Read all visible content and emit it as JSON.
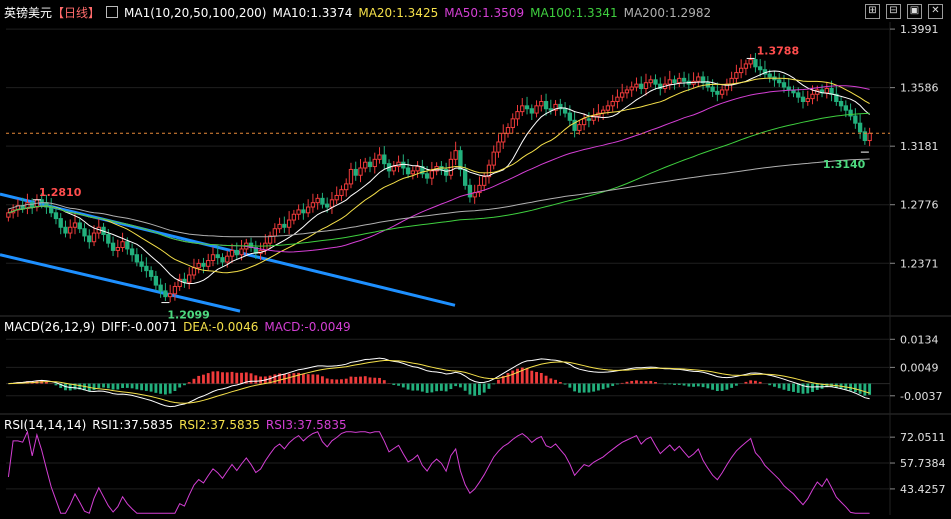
{
  "header": {
    "symbol": "英镑美元",
    "period": "【日线】",
    "settings_glyph": "⊕",
    "ma_title": "MA1(10,20,50,100,200)",
    "ma10": "MA10:1.3374",
    "ma20": "MA20:1.3425",
    "ma50": "MA50:1.3509",
    "ma100": "MA100:1.3341",
    "ma200": "MA200:1.2982"
  },
  "toolbar": {
    "icons": [
      "crosshair-icon",
      "grid-icon",
      "layout-icon",
      "close-icon"
    ],
    "glyphs": [
      "⊞",
      "⊟",
      "▣",
      "✕"
    ]
  },
  "macd_header": {
    "title": "MACD(26,12,9)",
    "diff": "DIFF:-0.0071",
    "dea": "DEA:-0.0046",
    "macd": "MACD:-0.0049"
  },
  "rsi_header": {
    "title": "RSI(14,14,14)",
    "rsi1": "RSI1:37.5835",
    "rsi2": "RSI2:37.5835",
    "rsi3": "RSI3:37.5835"
  },
  "colors": {
    "up": "#ef3b3b",
    "down": "#22b07d",
    "ma10": "#ffffff",
    "ma20": "#f5e04a",
    "ma50": "#d43fd4",
    "ma100": "#3fcf3f",
    "ma200": "#b0b0b0",
    "trend": "#1e90ff",
    "price_line": "#e88a3a",
    "rsi": "#d43fd4",
    "grid": "#1f1f1f"
  },
  "chart_data": [
    {
      "type": "candlestick",
      "title": "英镑美元【日线】",
      "yticks": [
        "1.3991",
        "1.3586",
        "1.3181",
        "1.2776",
        "1.2371"
      ],
      "ylim": [
        1.202,
        1.404
      ],
      "annotations": [
        {
          "label": "1.3788",
          "value": 1.3788
        },
        {
          "label": "1.2810",
          "value": 1.281
        },
        {
          "label": "1.2099",
          "value": 1.2099
        },
        {
          "label": "1.3140",
          "value": 1.314
        }
      ],
      "last_price": 1.327,
      "moving_averages": {
        "MA10": 1.3374,
        "MA20": 1.3425,
        "MA50": 1.3509,
        "MA100": 1.3341,
        "MA200": 1.2982
      },
      "closes": [
        1.272,
        1.274,
        1.277,
        1.275,
        1.279,
        1.276,
        1.281,
        1.279,
        1.276,
        1.272,
        1.268,
        1.262,
        1.258,
        1.262,
        1.265,
        1.261,
        1.256,
        1.252,
        1.258,
        1.262,
        1.257,
        1.251,
        1.246,
        1.248,
        1.252,
        1.247,
        1.243,
        1.238,
        1.235,
        1.232,
        1.228,
        1.222,
        1.218,
        1.214,
        1.216,
        1.221,
        1.226,
        1.224,
        1.229,
        1.234,
        1.237,
        1.235,
        1.239,
        1.243,
        1.241,
        1.238,
        1.242,
        1.246,
        1.243,
        1.247,
        1.251,
        1.248,
        1.244,
        1.246,
        1.251,
        1.256,
        1.261,
        1.264,
        1.262,
        1.267,
        1.271,
        1.274,
        1.272,
        1.276,
        1.279,
        1.282,
        1.278,
        1.276,
        1.281,
        1.284,
        1.288,
        1.292,
        1.302,
        1.298,
        1.303,
        1.307,
        1.304,
        1.309,
        1.312,
        1.306,
        1.301,
        1.304,
        1.307,
        1.303,
        1.299,
        1.301,
        1.304,
        1.299,
        1.296,
        1.301,
        1.304,
        1.302,
        1.298,
        1.309,
        1.315,
        1.302,
        1.291,
        1.283,
        1.286,
        1.291,
        1.297,
        1.305,
        1.314,
        1.321,
        1.327,
        1.331,
        1.337,
        1.342,
        1.346,
        1.344,
        1.341,
        1.346,
        1.349,
        1.344,
        1.343,
        1.347,
        1.344,
        1.341,
        1.336,
        1.329,
        1.333,
        1.337,
        1.336,
        1.339,
        1.341,
        1.343,
        1.346,
        1.349,
        1.352,
        1.355,
        1.357,
        1.359,
        1.361,
        1.358,
        1.362,
        1.364,
        1.361,
        1.358,
        1.361,
        1.364,
        1.362,
        1.365,
        1.363,
        1.361,
        1.363,
        1.366,
        1.362,
        1.359,
        1.356,
        1.354,
        1.357,
        1.361,
        1.365,
        1.369,
        1.372,
        1.375,
        1.378,
        1.373,
        1.371,
        1.368,
        1.366,
        1.364,
        1.362,
        1.359,
        1.357,
        1.355,
        1.352,
        1.349,
        1.351,
        1.354,
        1.357,
        1.355,
        1.358,
        1.354,
        1.349,
        1.346,
        1.343,
        1.339,
        1.334,
        1.328,
        1.322,
        1.327
      ]
    },
    {
      "type": "bar",
      "title": "MACD(26,12,9)",
      "yticks": [
        "0.0134",
        "0.0049",
        "-0.0037"
      ],
      "ylim": [
        -0.008,
        0.015
      ],
      "series": [
        {
          "name": "DIFF",
          "value": -0.0071
        },
        {
          "name": "DEA",
          "value": -0.0046
        },
        {
          "name": "MACD",
          "value": -0.0049
        }
      ]
    },
    {
      "type": "line",
      "title": "RSI(14,14,14)",
      "yticks": [
        "72.0511",
        "57.7384",
        "43.4257"
      ],
      "ylim": [
        29,
        76
      ],
      "series": [
        {
          "name": "RSI1",
          "value": 37.5835
        },
        {
          "name": "RSI2",
          "value": 37.5835
        },
        {
          "name": "RSI3",
          "value": 37.5835
        }
      ]
    }
  ]
}
